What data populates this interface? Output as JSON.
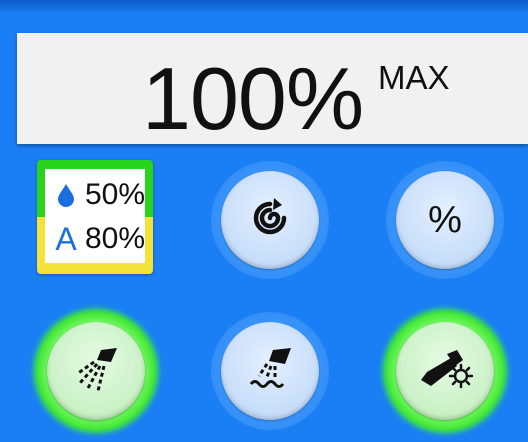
{
  "display": {
    "value": "100%",
    "unit": "MAX"
  },
  "ratio": {
    "water": "50%",
    "air": "80%",
    "air_letter": "A"
  },
  "buttons": {
    "swirl": {
      "icon": "swirl-icon",
      "active": false
    },
    "percent": {
      "label": "%",
      "active": false
    },
    "spray": {
      "icon": "spray-icon",
      "active": true
    },
    "water_jet": {
      "icon": "water-jet-icon",
      "active": false
    },
    "light": {
      "icon": "handpiece-light-icon",
      "active": true
    }
  },
  "colors": {
    "background": "#1a7ff5",
    "active_green": "#3ef12e",
    "water_blue": "#1a6fe0",
    "air_yellow": "#f3e23a"
  }
}
